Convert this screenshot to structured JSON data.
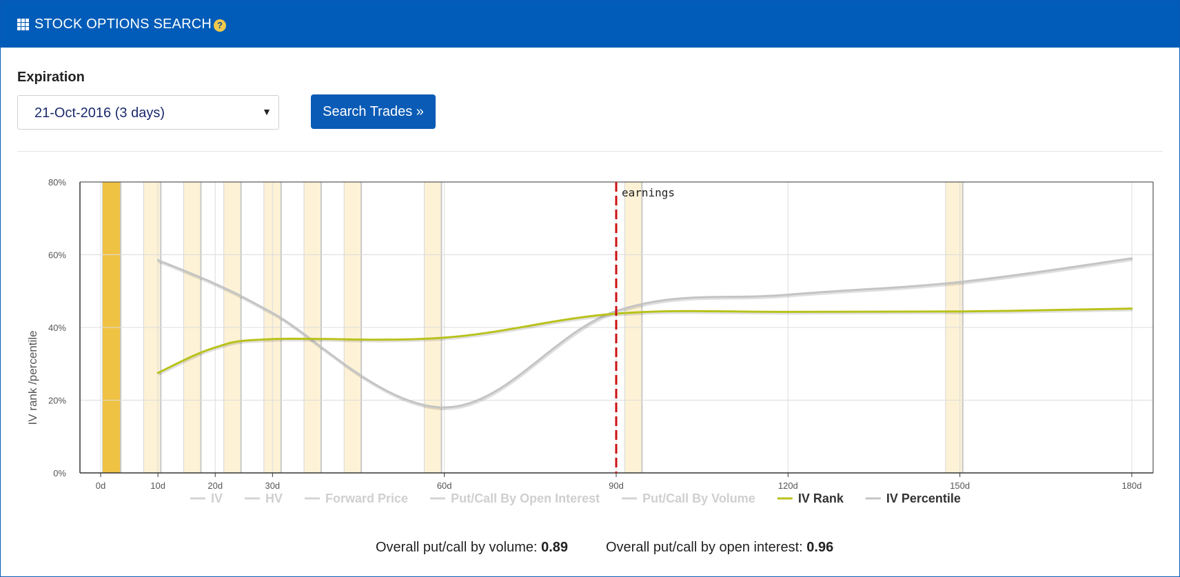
{
  "header": {
    "title": "STOCK OPTIONS SEARCH",
    "help_icon": "?"
  },
  "form": {
    "expiration_label": "Expiration",
    "expiration_value": "21-Oct-2016 (3 days)",
    "search_button": "Search Trades »"
  },
  "summary": {
    "volume_label": "Overall put/call by volume:",
    "volume_value": "0.89",
    "oi_label": "Overall put/call by open interest:",
    "oi_value": "0.96"
  },
  "colors": {
    "header": "#005cb8",
    "iv_rank": "#b8c21a",
    "iv_percentile": "#c4c4c4",
    "band": "#fdf2d6",
    "band_active": "#f0c244",
    "earnings": "#cc1111"
  },
  "chart_data": {
    "type": "line",
    "ylabel": "IV rank /percentile",
    "xlim": [
      0,
      180
    ],
    "ylim": [
      0,
      80
    ],
    "x_ticks": [
      "0d",
      "10d",
      "20d",
      "30d",
      "60d",
      "90d",
      "120d",
      "150d",
      "180d"
    ],
    "x_tick_values": [
      0,
      10,
      20,
      30,
      60,
      90,
      120,
      150,
      180
    ],
    "y_ticks": [
      "0%",
      "20%",
      "40%",
      "60%",
      "80%"
    ],
    "y_tick_values": [
      0,
      20,
      40,
      60,
      80
    ],
    "grid": true,
    "legend": [
      {
        "name": "IV",
        "active": false
      },
      {
        "name": "HV",
        "active": false
      },
      {
        "name": "Forward Price",
        "active": false
      },
      {
        "name": "Put/Call By Open Interest",
        "active": false
      },
      {
        "name": "Put/Call By Volume",
        "active": false
      },
      {
        "name": "IV Rank",
        "active": true
      },
      {
        "name": "IV Percentile",
        "active": true
      }
    ],
    "series": [
      {
        "name": "IV Rank",
        "x": [
          10,
          20,
          30,
          60,
          90,
          120,
          150,
          180
        ],
        "values": [
          27.5,
          34.5,
          36.8,
          37.2,
          43.8,
          44.3,
          44.4,
          45.2
        ]
      },
      {
        "name": "IV Percentile",
        "x": [
          10,
          20,
          30,
          60,
          90,
          120,
          150,
          180
        ],
        "values": [
          58.5,
          52,
          44,
          18,
          44.5,
          49,
          52.5,
          59
        ]
      }
    ],
    "expiry_bands": [
      {
        "start": 0.3,
        "end": 3.5,
        "selected": true
      },
      {
        "start": 7.5,
        "end": 10.5,
        "selected": false
      },
      {
        "start": 14.5,
        "end": 17.5,
        "selected": false
      },
      {
        "start": 21.5,
        "end": 24.5,
        "selected": false
      },
      {
        "start": 28.5,
        "end": 31.5,
        "selected": false
      },
      {
        "start": 35.5,
        "end": 38.5,
        "selected": false
      },
      {
        "start": 42.5,
        "end": 45.5,
        "selected": false
      },
      {
        "start": 56.5,
        "end": 59.5,
        "selected": false
      },
      {
        "start": 91.5,
        "end": 94.5,
        "selected": false
      },
      {
        "start": 147.5,
        "end": 150.5,
        "selected": false
      }
    ],
    "annotation": {
      "label": "earnings",
      "x": 90
    }
  }
}
